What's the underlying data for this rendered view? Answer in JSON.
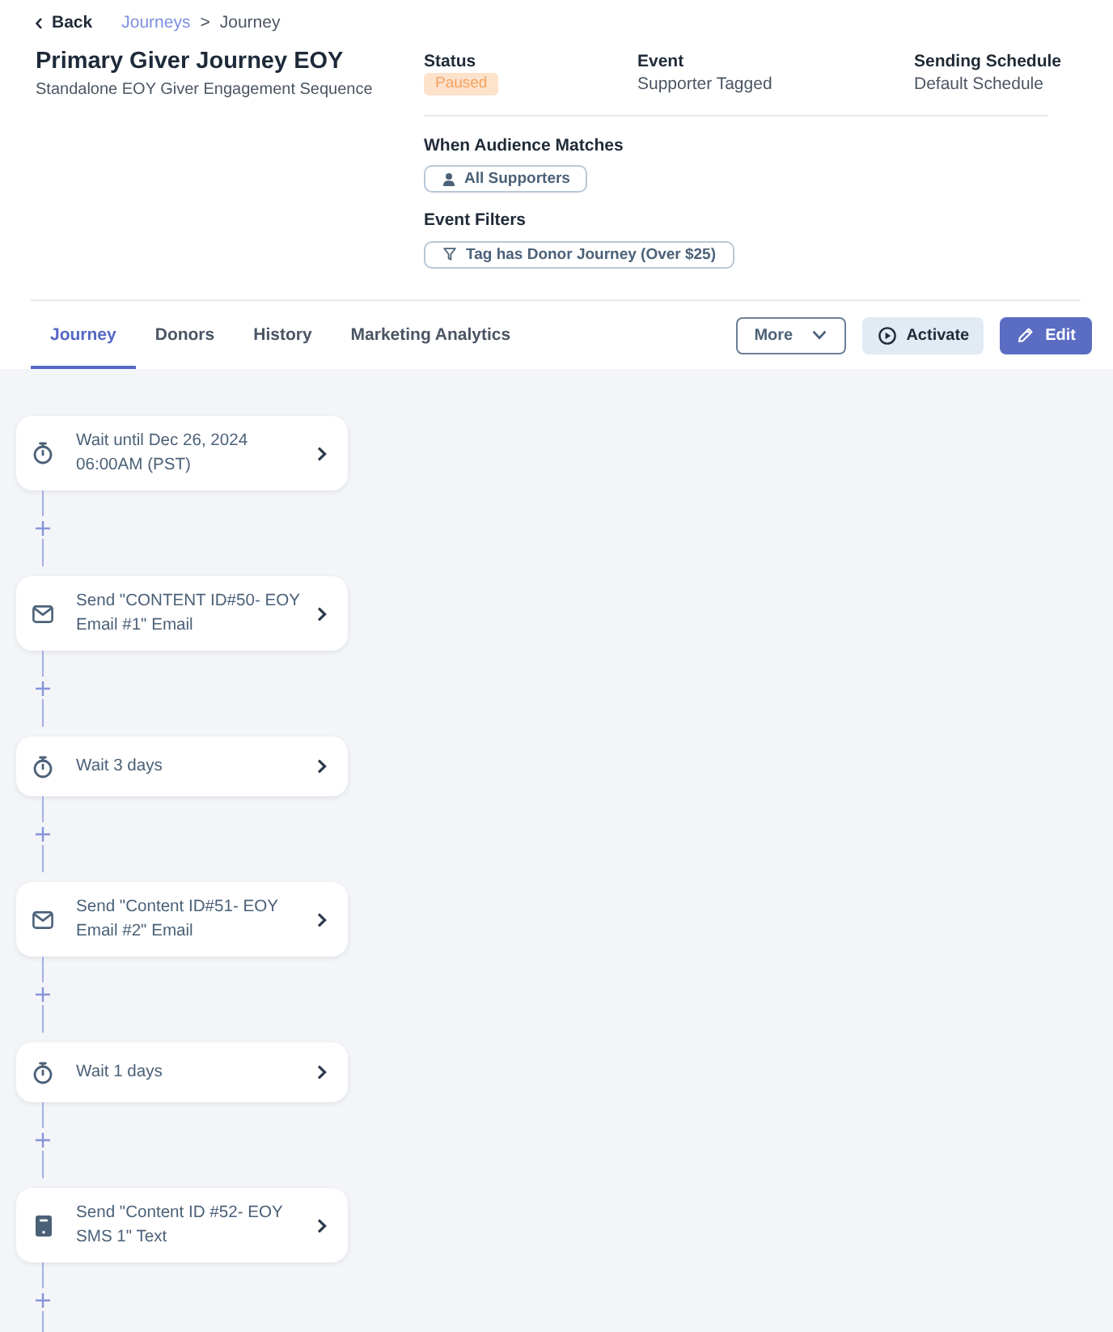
{
  "nav": {
    "back": "Back",
    "breadcrumb": {
      "parent": "Journeys",
      "separator": ">",
      "current": "Journey"
    }
  },
  "journey": {
    "title": "Primary Giver Journey EOY",
    "subtitle": "Standalone EOY Giver Engagement Sequence"
  },
  "details": [
    {
      "label": "Status",
      "kind": "badge",
      "value": "Paused"
    },
    {
      "label": "Event",
      "kind": "text",
      "value": "Supporter Tagged"
    },
    {
      "label": "Sending Schedule",
      "kind": "text",
      "value": "Default Schedule"
    }
  ],
  "conditions": [
    {
      "label": "When Audience Matches",
      "chips": [
        {
          "kind": "audience",
          "text": "All Supporters"
        }
      ]
    },
    {
      "label": "Event Filters",
      "chips": [
        {
          "kind": "filter",
          "text": "Tag has Donor Journey (Over $25)"
        }
      ]
    }
  ],
  "tabs": [
    {
      "label": "Journey",
      "selected": true
    },
    {
      "label": "Donors",
      "selected": false
    },
    {
      "label": "History",
      "selected": false
    },
    {
      "label": "Marketing Analytics",
      "selected": false
    }
  ],
  "actions": [
    {
      "label": "More",
      "kind": "dropdown"
    },
    {
      "label": "Activate",
      "kind": "secondary"
    },
    {
      "label": "Edit",
      "kind": "primary"
    }
  ],
  "steps": [
    {
      "kind": "wait",
      "text": "Wait until Dec 26, 2024 06:00AM (PST)"
    },
    {
      "kind": "email",
      "text": "Send \"CONTENT ID#50- EOY Email #1\" Email"
    },
    {
      "kind": "wait",
      "text": "Wait 3 days"
    },
    {
      "kind": "email",
      "text": "Send \"Content ID#51- EOY Email #2\" Email"
    },
    {
      "kind": "wait",
      "text": "Wait 1 days"
    },
    {
      "kind": "sms",
      "text": "Send \"Content ID #52- EOY SMS 1\" Text"
    }
  ]
}
